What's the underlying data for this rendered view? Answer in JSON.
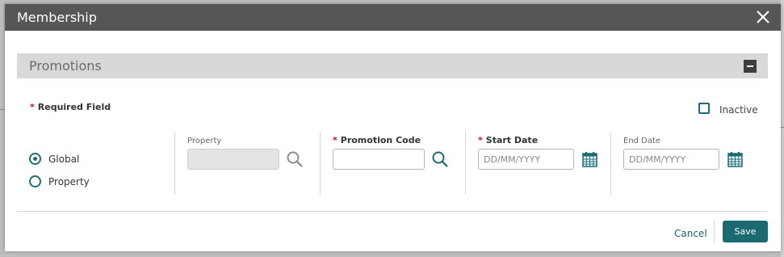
{
  "dialog": {
    "title": "Membership"
  },
  "section": {
    "title": "Promotions"
  },
  "form": {
    "required_note": "Required Field",
    "inactive_label": "Inactive",
    "inactive_checked": false,
    "scope_options": [
      {
        "label": "Global",
        "selected": true
      },
      {
        "label": "Property",
        "selected": false
      }
    ],
    "property": {
      "label": "Property",
      "value": ""
    },
    "promotion_code": {
      "label": "Promotion Code",
      "value": ""
    },
    "start_date": {
      "label": "Start Date",
      "placeholder": "DD/MM/YYYY"
    },
    "end_date": {
      "label": "End Date",
      "placeholder": "DD/MM/YYYY"
    }
  },
  "footer": {
    "cancel_label": "Cancel",
    "save_label": "Save"
  },
  "icons": {
    "close": "close-icon",
    "collapse": "minus-icon",
    "search": "search-icon",
    "calendar": "calendar-icon"
  },
  "colors": {
    "titlebar": "#575655",
    "accent": "#1b6a72",
    "required": "#c8102e"
  }
}
